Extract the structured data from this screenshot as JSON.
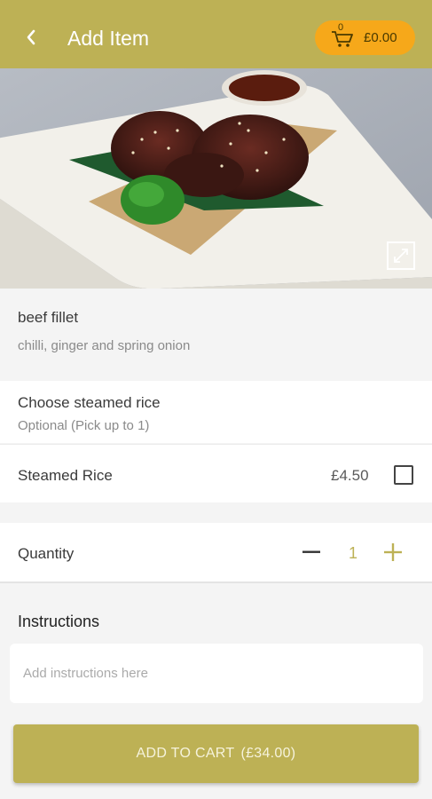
{
  "header": {
    "title": "Add Item",
    "back_icon": "chevron-left-icon",
    "cart": {
      "count": "0",
      "total": "£0.00",
      "icon": "cart-icon"
    }
  },
  "colors": {
    "brand": "#bdb155",
    "cart_pill": "#f6a81a",
    "background": "#f4f4f4"
  },
  "item": {
    "name": "beef fillet",
    "description": "chilli, ginger and spring onion"
  },
  "options": {
    "group_title": "Choose steamed rice",
    "group_subtitle": "Optional (Pick up to 1)",
    "items": [
      {
        "label": "Steamed Rice",
        "price": "£4.50",
        "checked": false
      }
    ]
  },
  "quantity": {
    "label": "Quantity",
    "value": "1"
  },
  "instructions": {
    "label": "Instructions",
    "placeholder": "Add instructions here",
    "value": ""
  },
  "add_to_cart": {
    "label": "ADD TO CART",
    "price": "(£34.00)"
  }
}
